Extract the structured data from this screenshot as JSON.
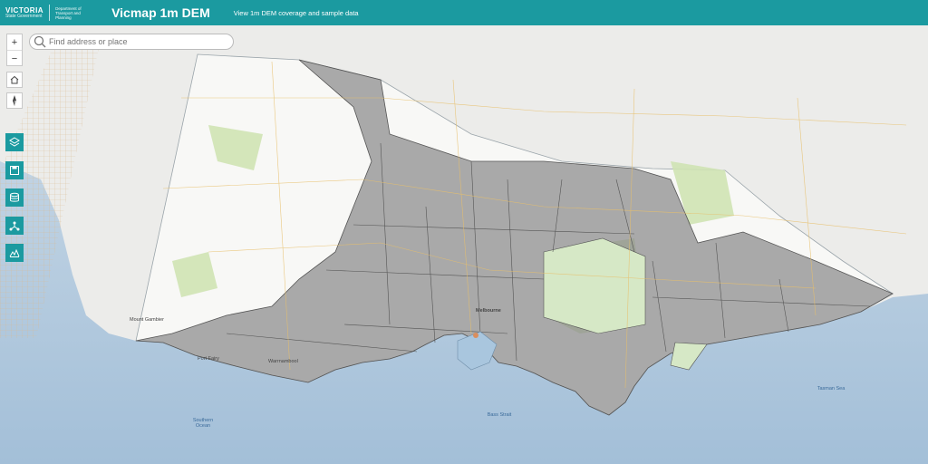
{
  "header": {
    "logo_text": "VICTORIA",
    "logo_subtext": "State Government",
    "department": "Department of Transport and Planning",
    "title": "Vicmap 1m DEM",
    "subtitle": "View 1m DEM coverage and sample data"
  },
  "search": {
    "placeholder": "Find address or place",
    "value": ""
  },
  "controls": {
    "zoom_in": "+",
    "zoom_out": "−"
  },
  "map_labels": {
    "southern_ocean": "Southern Ocean",
    "bass_strait": "Bass Strait",
    "tasman_sea": "Tasman Sea",
    "melbourne": "Melbourne",
    "mount_gambier": "Mount Gambier",
    "warrnambool": "Warrnambool",
    "port_fairy": "Port Fairy"
  },
  "colors": {
    "header": "#1b9aa0",
    "ocean": "#a9c6de",
    "land": "#f4f4f2",
    "coverage": "#8a8a8a",
    "vegetation": "#cfe3b4"
  }
}
